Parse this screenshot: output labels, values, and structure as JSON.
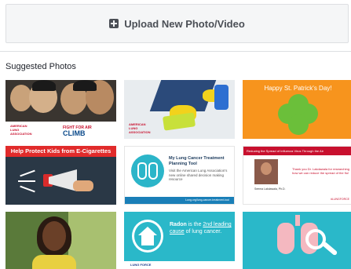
{
  "upload": {
    "label": "Upload New Photo/Video",
    "icon": "plus-square-icon"
  },
  "suggested": {
    "title": "Suggested Photos",
    "tiles": [
      {
        "id": "firefighters",
        "texts": {
          "org": "AMERICAN LUNG ASSOCIATION",
          "fight": "FIGHT FOR AIR",
          "climb": "CLIMB"
        }
      },
      {
        "id": "cleaning",
        "texts": {
          "org": "AMERICAN LUNG ASSOCIATION"
        }
      },
      {
        "id": "st-patricks",
        "texts": {
          "headline": "Happy St. Patrick's Day!"
        }
      },
      {
        "id": "e-cigarettes",
        "texts": {
          "headline": "Help Protect Kids from E-Cigarettes"
        }
      },
      {
        "id": "lung-cancer-tool",
        "texts": {
          "title": "My Lung Cancer Treatment Planning Tool",
          "sub": "Visit the American Lung Association's new online shared decision making resource",
          "foot": "Lung.org/lung-cancer-treatment-tool"
        }
      },
      {
        "id": "influenza",
        "texts": {
          "headline": "Reducing the Spread of Influenza Virus Through the Air",
          "quote": "Thank you Dr. Lakdawala for researching how we can reduce the spread of the flu!",
          "name": "Seema Lakdawala, Ph.D.",
          "tag": "#LUNGFORCE"
        }
      },
      {
        "id": "woman-portrait",
        "texts": {}
      },
      {
        "id": "radon",
        "texts": {
          "radon": "Radon",
          "rest1": " is the ",
          "cause": "2nd leading cause",
          "rest2": " of lung cancer.",
          "foot": "LUNG FORCE"
        }
      },
      {
        "id": "lungs-magnifier",
        "texts": {}
      }
    ]
  },
  "colors": {
    "accent_red": "#c8102e",
    "teal": "#2ab8c9",
    "orange": "#f7941d"
  }
}
